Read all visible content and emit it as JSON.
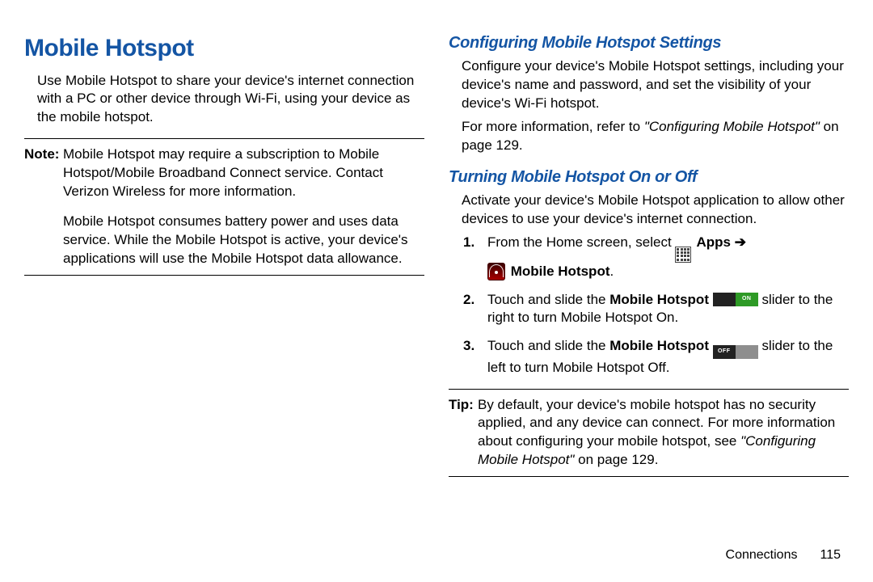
{
  "left": {
    "title": "Mobile Hotspot",
    "intro": "Use Mobile Hotspot to share your device's internet connection with a PC or other device through Wi-Fi, using your device as the mobile hotspot.",
    "note_label": "Note:",
    "note_p1": "Mobile Hotspot may require a subscription to Mobile Hotspot/Mobile Broadband Connect service. Contact Verizon Wireless for more information.",
    "note_p2": "Mobile Hotspot consumes battery power and uses data service. While the Mobile Hotspot is active, your device's applications will use the Mobile Hotspot data allowance."
  },
  "right": {
    "h_config": "Configuring Mobile Hotspot Settings",
    "config_p1": "Configure your device's Mobile Hotspot settings, including your device's name and password, and set the visibility of your device's Wi-Fi hotspot.",
    "config_p2a": "For more information, refer to ",
    "config_p2_ref": "\"Configuring Mobile Hotspot\"",
    "config_p2b": " on page 129.",
    "h_turn": "Turning Mobile Hotspot On or Off",
    "turn_intro": "Activate your device's Mobile Hotspot application to allow other devices to use your device's internet connection.",
    "step1_a": "From the Home screen, select ",
    "step1_apps": " Apps ",
    "step1_arrow": "➔",
    "step1_mh": " Mobile Hotspot",
    "step1_period": ".",
    "step2_a": "Touch and slide the ",
    "step2_mh": "Mobile Hotspot",
    "slider_on_label": "ON",
    "slider_off_label": "OFF",
    "step2_b": " slider to the right to turn Mobile Hotspot On.",
    "step3_a": "Touch and slide the ",
    "step3_mh": "Mobile Hotspot",
    "step3_b": " slider to the left to turn Mobile Hotspot Off.",
    "tip_label": "Tip:",
    "tip_a": "By default, your device's mobile hotspot has no security applied, and any device can connect. For more information about configuring your mobile hotspot, see ",
    "tip_ref": "\"Configuring Mobile Hotspot\"",
    "tip_b": " on page 129."
  },
  "footer": {
    "section": "Connections",
    "page": "115"
  }
}
